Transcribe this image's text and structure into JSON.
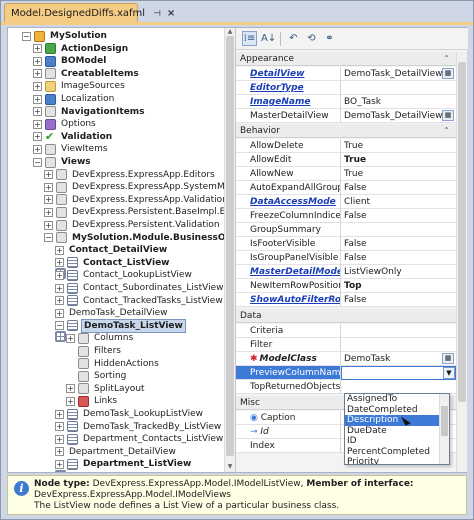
{
  "tab": {
    "title": "Model.DesignedDiffs.xafml",
    "pin": "⊣",
    "close": "×"
  },
  "tree": {
    "nodes": [
      {
        "label": "MySolution",
        "bold": true,
        "toggle": "−",
        "icon": "solution"
      },
      {
        "label": "ActionDesign",
        "bold": true,
        "toggle": "+",
        "icon": "green"
      },
      {
        "label": "BOModel",
        "bold": true,
        "toggle": "+",
        "icon": "blue"
      },
      {
        "label": "CreatableItems",
        "bold": true,
        "toggle": "+",
        "icon": "gray"
      },
      {
        "label": "ImageSources",
        "bold": false,
        "toggle": "+",
        "icon": "folder"
      },
      {
        "label": "Localization",
        "bold": false,
        "toggle": "+",
        "icon": "blue"
      },
      {
        "label": "NavigationItems",
        "bold": true,
        "toggle": "+",
        "icon": "gray"
      },
      {
        "label": "Options",
        "bold": false,
        "toggle": "+",
        "icon": "purple"
      },
      {
        "label": "Validation",
        "bold": true,
        "toggle": "+",
        "icon": "check"
      },
      {
        "label": "ViewItems",
        "bold": false,
        "toggle": "+",
        "icon": "gray"
      },
      {
        "label": "Views",
        "bold": true,
        "toggle": "−",
        "icon": "gray"
      },
      {
        "label": "DevExpress.ExpressApp.Editors",
        "bold": false,
        "toggle": "+",
        "icon": "gray"
      },
      {
        "label": "DevExpress.ExpressApp.SystemModule",
        "bold": false,
        "toggle": "+",
        "icon": "gray"
      },
      {
        "label": "DevExpress.ExpressApp.Validation.AllC…",
        "bold": false,
        "toggle": "+",
        "icon": "gray"
      },
      {
        "label": "DevExpress.Persistent.BaseImpl.EF",
        "bold": false,
        "toggle": "+",
        "icon": "gray"
      },
      {
        "label": "DevExpress.Persistent.Validation",
        "bold": false,
        "toggle": "+",
        "icon": "gray"
      },
      {
        "label": "MySolution.Module.BusinessObjects",
        "bold": true,
        "toggle": "−",
        "icon": "gray"
      },
      {
        "label": "Contact_DetailView",
        "bold": true,
        "toggle": "+",
        "icon": "grid"
      },
      {
        "label": "Contact_ListView",
        "bold": true,
        "toggle": "+",
        "icon": "list"
      },
      {
        "label": "Contact_LookupListView",
        "bold": false,
        "toggle": "+",
        "icon": "list"
      },
      {
        "label": "Contact_Subordinates_ListView",
        "bold": false,
        "toggle": "+",
        "icon": "list"
      },
      {
        "label": "Contact_TrackedTasks_ListView",
        "bold": false,
        "toggle": "+",
        "icon": "list"
      },
      {
        "label": "DemoTask_DetailView",
        "bold": false,
        "toggle": "+",
        "icon": "grid"
      },
      {
        "label": "DemoTask_ListView",
        "bold": true,
        "toggle": "−",
        "icon": "list",
        "selected": true
      },
      {
        "label": "Columns",
        "bold": false,
        "toggle": "+",
        "icon": "gray"
      },
      {
        "label": "Filters",
        "bold": false,
        "toggle": "",
        "icon": "gray"
      },
      {
        "label": "HiddenActions",
        "bold": false,
        "toggle": "",
        "icon": "gray"
      },
      {
        "label": "Sorting",
        "bold": false,
        "toggle": "",
        "icon": "gray"
      },
      {
        "label": "SplitLayout",
        "bold": false,
        "toggle": "+",
        "icon": "gray"
      },
      {
        "label": "Links",
        "bold": false,
        "toggle": "+",
        "icon": "red"
      },
      {
        "label": "DemoTask_LookupListView",
        "bold": false,
        "toggle": "+",
        "icon": "list"
      },
      {
        "label": "DemoTask_TrackedBy_ListView",
        "bold": false,
        "toggle": "+",
        "icon": "list"
      },
      {
        "label": "Department_Contacts_ListView",
        "bold": false,
        "toggle": "+",
        "icon": "list"
      },
      {
        "label": "Department_DetailView",
        "bold": false,
        "toggle": "+",
        "icon": "grid"
      },
      {
        "label": "Department_ListView",
        "bold": true,
        "toggle": "+",
        "icon": "list"
      }
    ]
  },
  "toolbar": {
    "categorized": "⁞≡",
    "alphabetical": "A↓",
    "undo": "↶",
    "reset": "⟲",
    "link": "⚭"
  },
  "propertyGrid": {
    "appearance": "Appearance",
    "behavior": "Behavior",
    "data": "Data",
    "misc": "Misc",
    "collapse": "⌃",
    "rows": {
      "detailView": {
        "name": "DetailView",
        "value": "DemoTask_DetailView"
      },
      "editorType": {
        "name": "EditorType",
        "value": ""
      },
      "imageName": {
        "name": "ImageName",
        "value": "BO_Task"
      },
      "masterDetailView": {
        "name": "MasterDetailView",
        "value": "DemoTask_DetailView"
      },
      "allowDelete": {
        "name": "AllowDelete",
        "value": "True"
      },
      "allowEdit": {
        "name": "AllowEdit",
        "value": "True"
      },
      "allowNew": {
        "name": "AllowNew",
        "value": "True"
      },
      "autoExpandAllGroups": {
        "name": "AutoExpandAllGroups",
        "value": "False"
      },
      "dataAccessMode": {
        "name": "DataAccessMode",
        "value": "Client"
      },
      "freezeColumnIndices": {
        "name": "FreezeColumnIndices",
        "value": "False"
      },
      "groupSummary": {
        "name": "GroupSummary",
        "value": ""
      },
      "isFooterVisible": {
        "name": "IsFooterVisible",
        "value": "False"
      },
      "isGroupPanelVisible": {
        "name": "IsGroupPanelVisible",
        "value": "False"
      },
      "masterDetailMode": {
        "name": "MasterDetailMode",
        "value": "ListViewOnly"
      },
      "newItemRowPosition": {
        "name": "NewItemRowPosition",
        "value": "Top"
      },
      "showAutoFilterRow": {
        "name": "ShowAutoFilterRow",
        "value": "False"
      },
      "criteria": {
        "name": "Criteria",
        "value": ""
      },
      "filter": {
        "name": "Filter",
        "value": ""
      },
      "modelClass": {
        "name": "ModelClass",
        "value": "DemoTask"
      },
      "previewColumnName": {
        "name": "PreviewColumnName",
        "value": ""
      },
      "topReturnedObjects": {
        "name": "TopReturnedObjects",
        "value": ""
      },
      "caption": {
        "name": "Caption",
        "value": ""
      },
      "id": {
        "name": "Id",
        "value": ""
      },
      "index": {
        "name": "Index",
        "value": ""
      }
    }
  },
  "dropdown": {
    "options": [
      "AssignedTo",
      "DateCompleted",
      "Description",
      "DueDate",
      "ID",
      "PercentCompleted",
      "Priority"
    ],
    "highlighted": "Description"
  },
  "description": {
    "nodeTypeLabel": "Node type:",
    "nodeType": "DevExpress.ExpressApp.Model.IModelListView,",
    "memberLabel": "Member of interface:",
    "memberOf": "DevExpress.ExpressApp.Model.IModelViews",
    "text": "The ListView node defines a List View of a particular business class."
  }
}
